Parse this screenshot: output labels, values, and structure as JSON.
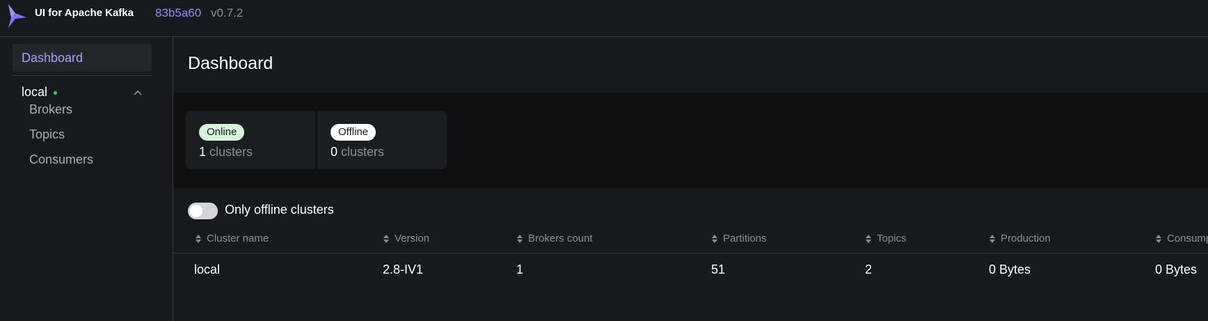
{
  "header": {
    "app_title": "UI for Apache Kafka",
    "commit": "83b5a60",
    "version": "v0.7.2"
  },
  "sidebar": {
    "dashboard_label": "Dashboard",
    "cluster": {
      "name": "local",
      "status": "online",
      "expanded": true,
      "items": [
        {
          "label": "Brokers"
        },
        {
          "label": "Topics"
        },
        {
          "label": "Consumers"
        }
      ]
    }
  },
  "main": {
    "title": "Dashboard",
    "stats": {
      "online": {
        "badge": "Online",
        "count": "1",
        "unit": "clusters"
      },
      "offline": {
        "badge": "Offline",
        "count": "0",
        "unit": "clusters"
      }
    },
    "filter_toggle": {
      "label": "Only offline clusters",
      "on": false
    },
    "table": {
      "headers": [
        "Cluster name",
        "Version",
        "Brokers count",
        "Partitions",
        "Topics",
        "Production",
        "Consumption"
      ],
      "rows": [
        [
          "local",
          "2.8-IV1",
          "1",
          "51",
          "2",
          "0 Bytes",
          "0 Bytes"
        ]
      ]
    }
  },
  "colors": {
    "accent": "#a6a2ff",
    "online_badge": "#d6f5dc",
    "status_dot": "#3ecf6b"
  }
}
